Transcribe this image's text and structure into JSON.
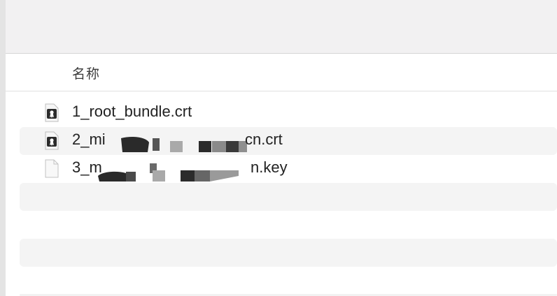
{
  "table": {
    "column_name": "名称"
  },
  "files": [
    {
      "name": "1_root_bundle.crt",
      "icon": "certificate-icon"
    },
    {
      "name": "2_mi",
      "name_suffix": "cn.crt",
      "icon": "certificate-icon"
    },
    {
      "name": "3_m",
      "name_suffix": "n.key",
      "icon": "document-icon"
    }
  ],
  "colors": {
    "toolbar_bg": "#f2f1f2",
    "alt_row_bg": "#f4f4f4",
    "text": "#222222"
  }
}
